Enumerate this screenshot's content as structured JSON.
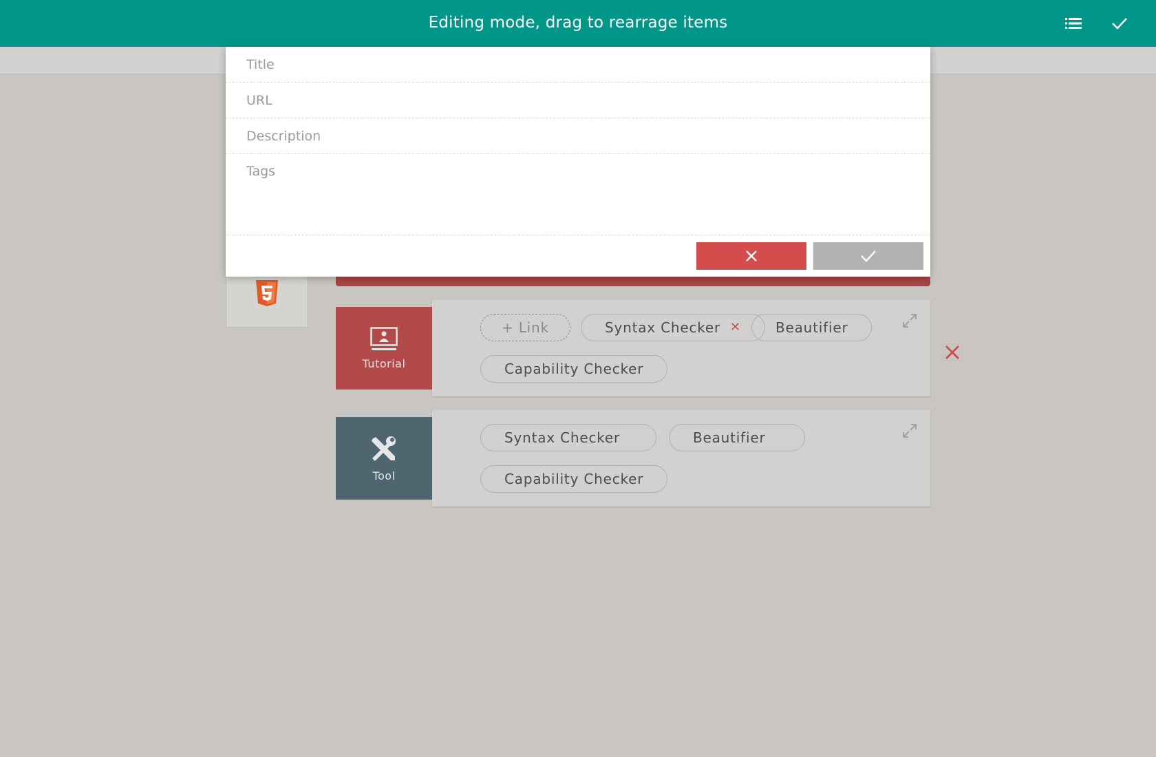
{
  "header": {
    "title": "Editing mode, drag to rearrage items",
    "list_icon": "list-icon",
    "done_icon": "check-icon"
  },
  "form": {
    "title_placeholder": "Title",
    "url_placeholder": "URL",
    "description_placeholder": "Description",
    "tags_placeholder": "Tags",
    "cancel_icon": "close-icon",
    "confirm_icon": "check-icon"
  },
  "background_card": {
    "icon": "html5-icon"
  },
  "rows": [
    {
      "category": "Tutorial",
      "icon": "presentation-icon",
      "color": "#b34a4a",
      "add_link_label": "+ Link",
      "chips": [
        "Syntax Checker",
        "Beautifier",
        "Capability Checker"
      ]
    },
    {
      "category": "Tool",
      "icon": "wrench-screwdriver-icon",
      "color": "#4f6671",
      "chips": [
        "Syntax Checker",
        "Beautifier",
        "Capability Checker"
      ]
    }
  ],
  "colors": {
    "header": "#00968a",
    "background": "#c9c6c1",
    "danger": "#d44c4b",
    "tutorial": "#b34a4a",
    "tool": "#4f6671"
  }
}
